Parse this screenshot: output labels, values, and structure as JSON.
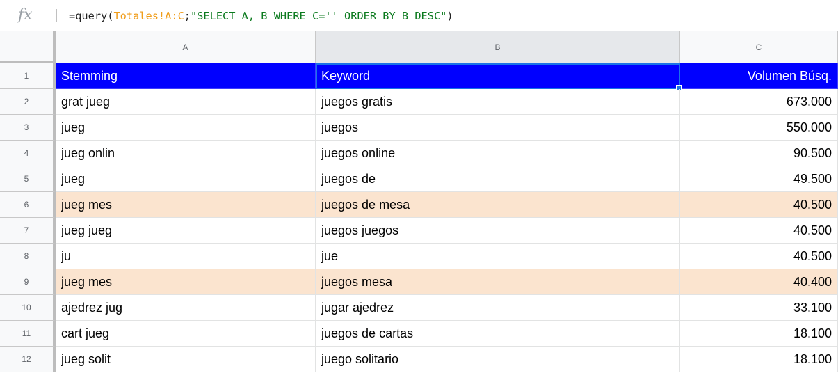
{
  "formula_bar": {
    "icon": "fx-icon",
    "formula_prefix": "=query(",
    "formula_ref": "Totales!A:C",
    "formula_sep": ";",
    "formula_string": "\"SELECT A, B WHERE C='' ORDER BY B DESC\"",
    "formula_suffix": ")"
  },
  "columns": [
    {
      "letter": "A"
    },
    {
      "letter": "B",
      "selected": true
    },
    {
      "letter": "C"
    }
  ],
  "colors": {
    "header_fill": "#0000ff",
    "highlight_fill": "#fbe4cf",
    "selection": "#1a73e8",
    "formula_reference": "#f09d1a",
    "formula_string": "#0b7a1e"
  },
  "rows": [
    {
      "num": "1",
      "a": "Stemming",
      "b": "Keyword",
      "c": "Volumen Búsq.",
      "style": "header"
    },
    {
      "num": "2",
      "a": "grat jueg",
      "b": "juegos gratis",
      "c": "673.000",
      "style": ""
    },
    {
      "num": "3",
      "a": "jueg",
      "b": "juegos",
      "c": "550.000",
      "style": ""
    },
    {
      "num": "4",
      "a": "jueg onlin",
      "b": "juegos online",
      "c": "90.500",
      "style": ""
    },
    {
      "num": "5",
      "a": "jueg",
      "b": "juegos de",
      "c": "49.500",
      "style": ""
    },
    {
      "num": "6",
      "a": "jueg mes",
      "b": "juegos de mesa",
      "c": "40.500",
      "style": "highlight"
    },
    {
      "num": "7",
      "a": "jueg jueg",
      "b": "juegos juegos",
      "c": "40.500",
      "style": ""
    },
    {
      "num": "8",
      "a": "ju",
      "b": "jue",
      "c": "40.500",
      "style": ""
    },
    {
      "num": "9",
      "a": "jueg mes",
      "b": "juegos mesa",
      "c": "40.400",
      "style": "highlight"
    },
    {
      "num": "10",
      "a": "ajedrez jug",
      "b": "jugar ajedrez",
      "c": "33.100",
      "style": ""
    },
    {
      "num": "11",
      "a": "cart jueg",
      "b": "juegos de cartas",
      "c": "18.100",
      "style": ""
    },
    {
      "num": "12",
      "a": "jueg solit",
      "b": "juego solitario",
      "c": "18.100",
      "style": ""
    }
  ]
}
